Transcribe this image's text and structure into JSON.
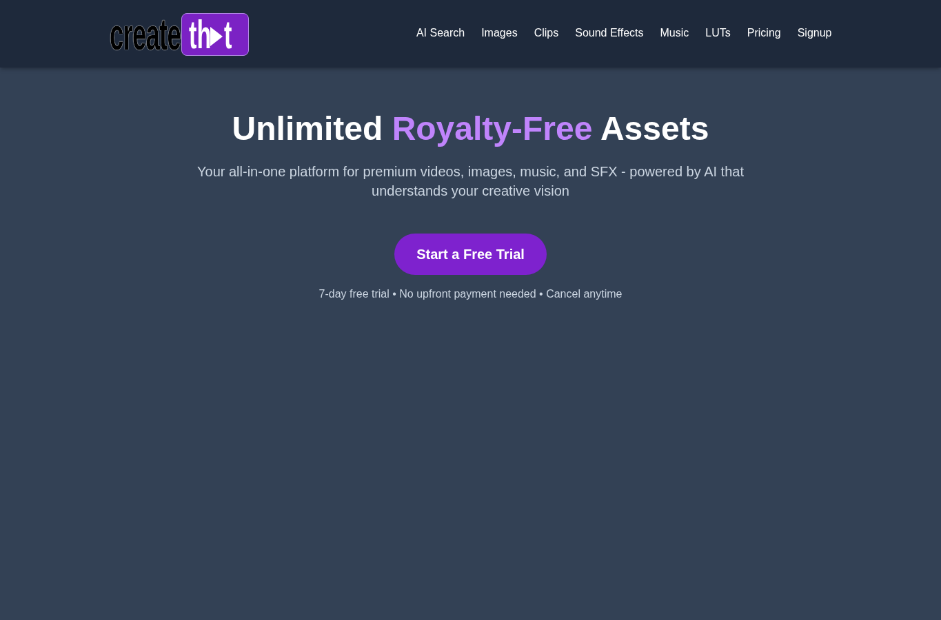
{
  "header": {
    "logo": {
      "wordmark": "create",
      "badge_text_before": "th",
      "badge_text_after": "t"
    },
    "nav": [
      "AI Search",
      "Images",
      "Clips",
      "Sound Effects",
      "Music",
      "LUTs",
      "Pricing",
      "Signup"
    ]
  },
  "hero": {
    "title": [
      {
        "text": "Unlimited",
        "highlight": false
      },
      {
        "text": "Royalty-Free",
        "highlight": true
      },
      {
        "text": "Assets",
        "highlight": false
      }
    ],
    "subtitle": "Your all-in-one platform for premium videos, images, music, and SFX - powered by AI that understands your creative vision",
    "cta": "Start a Free Trial",
    "note": "7-day free trial • No upfront payment needed • Cancel anytime"
  }
}
